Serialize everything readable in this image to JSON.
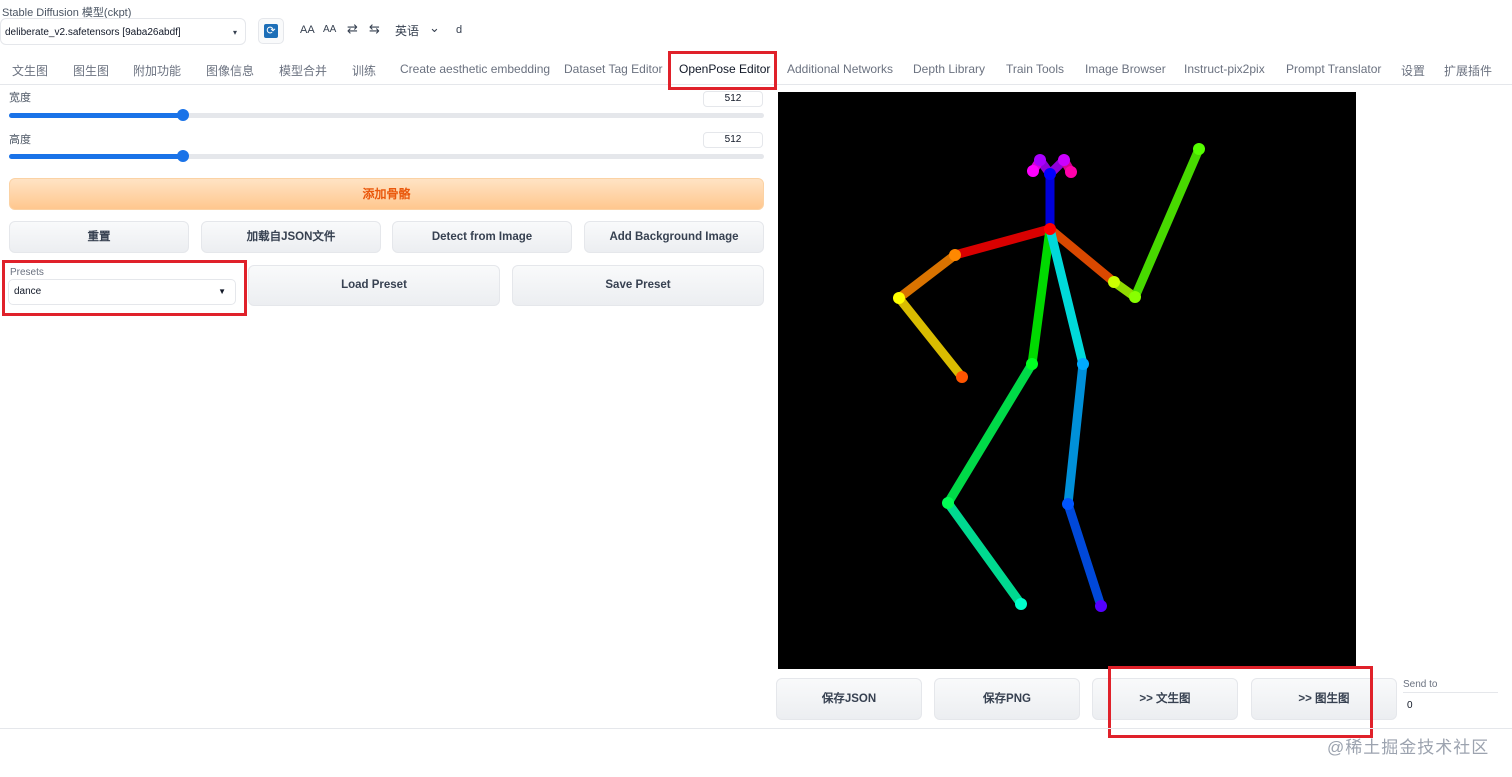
{
  "model": {
    "label": "Stable Diffusion 模型(ckpt)",
    "selected": "deliberate_v2.safetensors [9aba26abdf]",
    "caret": "▾"
  },
  "toolbar": {
    "font_large": "AA",
    "font_small": "AA",
    "swap1": "⇄",
    "swap2": "⇆",
    "language": "英语",
    "language_caret": "⌄",
    "extra": "d",
    "refresh_icon": "⟳"
  },
  "tabs": [
    "文生图",
    "图生图",
    "附加功能",
    "图像信息",
    "模型合并",
    "训练",
    "Create aesthetic embedding",
    "Dataset Tag Editor",
    "OpenPose Editor",
    "Additional Networks",
    "Depth Library",
    "Train Tools",
    "Image Browser",
    "Instruct-pix2pix",
    "Prompt Translator",
    "设置",
    "扩展插件"
  ],
  "width_slider": {
    "label": "宽度",
    "value": "512",
    "fraction": 0.23
  },
  "height_slider": {
    "label": "高度",
    "value": "512",
    "fraction": 0.23
  },
  "add_bone_button": "添加骨骼",
  "buttons": {
    "reset": "重置",
    "load_json": "加载自JSON文件",
    "detect": "Detect from Image",
    "add_bg": "Add Background Image",
    "load_preset": "Load Preset",
    "save_preset": "Save Preset",
    "save_json": "保存JSON",
    "save_png": "保存PNG",
    "to_txt2img": ">> 文生图",
    "to_img2img": ">> 图生图"
  },
  "presets": {
    "label": "Presets",
    "selected": "dance",
    "caret": "▼"
  },
  "send_to": {
    "label": "Send to",
    "value": "0"
  },
  "watermark": "@稀土掘金技术社区",
  "colors": {
    "accent": "#1a73e8",
    "highlight": "#e0212a",
    "primary_text": "#ea580c"
  }
}
